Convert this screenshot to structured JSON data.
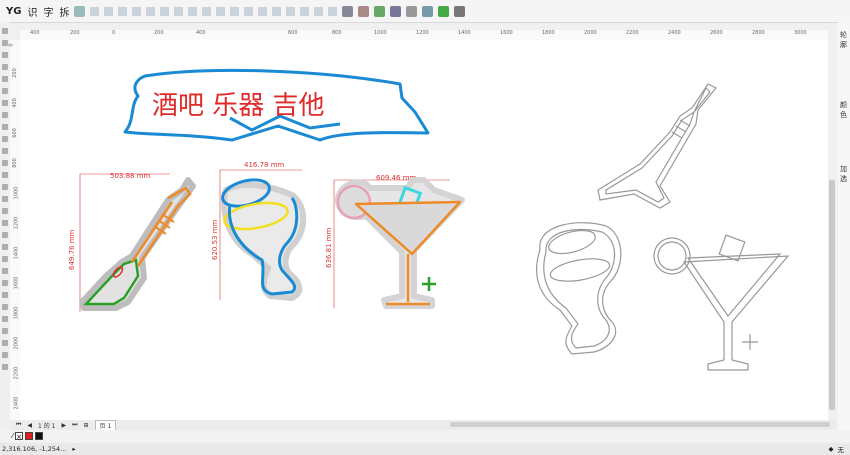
{
  "toolbar": {
    "btn_yg": "YG",
    "btn_identify": "识",
    "btn_font": "字",
    "btn_split": "拆"
  },
  "ruler": {
    "top_ticks": [
      "400",
      "200",
      "0",
      "200",
      "400",
      "600",
      "800",
      "1000",
      "1200",
      "1400",
      "1600",
      "1800",
      "2000",
      "2200",
      "2400",
      "2600",
      "2800",
      "3000"
    ],
    "left_ticks": [
      "2400",
      "2200",
      "2000",
      "1800",
      "1600",
      "1400",
      "1200",
      "1000",
      "800",
      "600",
      "400",
      "200",
      "0"
    ]
  },
  "canvas": {
    "title": "酒吧 乐器 吉他",
    "guitar_width": "503.88 mm",
    "guitar_height": "649.76 mm",
    "glass_width": "416.78 mm",
    "glass_height": "620.53 mm",
    "cocktail_width": "609.46 mm",
    "cocktail_height": "636.81 mm"
  },
  "right_panel": {
    "label_outline": "轮廓",
    "label_color": "颜色",
    "label_add": "加选"
  },
  "pagebar": {
    "page_counter": "1 的 1",
    "page_tab": "页 1"
  },
  "status": {
    "coords": "2,316.106, -1,254...",
    "none_label": "无"
  },
  "colors": {
    "accent_blue": "#1a8ad4",
    "title_red": "#e02a2a",
    "orange": "#ee8a2a",
    "green": "#2aa02a",
    "cyan": "#3dd6e0",
    "yellow": "#f2e020"
  }
}
